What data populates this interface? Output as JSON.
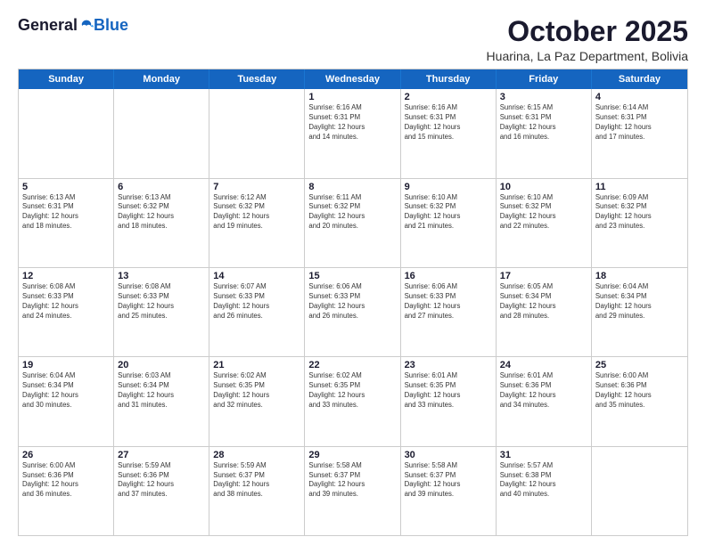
{
  "header": {
    "logo_general": "General",
    "logo_blue": "Blue",
    "month_title": "October 2025",
    "subtitle": "Huarina, La Paz Department, Bolivia"
  },
  "days_of_week": [
    "Sunday",
    "Monday",
    "Tuesday",
    "Wednesday",
    "Thursday",
    "Friday",
    "Saturday"
  ],
  "weeks": [
    [
      {
        "day": "",
        "info": ""
      },
      {
        "day": "",
        "info": ""
      },
      {
        "day": "",
        "info": ""
      },
      {
        "day": "1",
        "info": "Sunrise: 6:16 AM\nSunset: 6:31 PM\nDaylight: 12 hours\nand 14 minutes."
      },
      {
        "day": "2",
        "info": "Sunrise: 6:16 AM\nSunset: 6:31 PM\nDaylight: 12 hours\nand 15 minutes."
      },
      {
        "day": "3",
        "info": "Sunrise: 6:15 AM\nSunset: 6:31 PM\nDaylight: 12 hours\nand 16 minutes."
      },
      {
        "day": "4",
        "info": "Sunrise: 6:14 AM\nSunset: 6:31 PM\nDaylight: 12 hours\nand 17 minutes."
      }
    ],
    [
      {
        "day": "5",
        "info": "Sunrise: 6:13 AM\nSunset: 6:31 PM\nDaylight: 12 hours\nand 18 minutes."
      },
      {
        "day": "6",
        "info": "Sunrise: 6:13 AM\nSunset: 6:32 PM\nDaylight: 12 hours\nand 18 minutes."
      },
      {
        "day": "7",
        "info": "Sunrise: 6:12 AM\nSunset: 6:32 PM\nDaylight: 12 hours\nand 19 minutes."
      },
      {
        "day": "8",
        "info": "Sunrise: 6:11 AM\nSunset: 6:32 PM\nDaylight: 12 hours\nand 20 minutes."
      },
      {
        "day": "9",
        "info": "Sunrise: 6:10 AM\nSunset: 6:32 PM\nDaylight: 12 hours\nand 21 minutes."
      },
      {
        "day": "10",
        "info": "Sunrise: 6:10 AM\nSunset: 6:32 PM\nDaylight: 12 hours\nand 22 minutes."
      },
      {
        "day": "11",
        "info": "Sunrise: 6:09 AM\nSunset: 6:32 PM\nDaylight: 12 hours\nand 23 minutes."
      }
    ],
    [
      {
        "day": "12",
        "info": "Sunrise: 6:08 AM\nSunset: 6:33 PM\nDaylight: 12 hours\nand 24 minutes."
      },
      {
        "day": "13",
        "info": "Sunrise: 6:08 AM\nSunset: 6:33 PM\nDaylight: 12 hours\nand 25 minutes."
      },
      {
        "day": "14",
        "info": "Sunrise: 6:07 AM\nSunset: 6:33 PM\nDaylight: 12 hours\nand 26 minutes."
      },
      {
        "day": "15",
        "info": "Sunrise: 6:06 AM\nSunset: 6:33 PM\nDaylight: 12 hours\nand 26 minutes."
      },
      {
        "day": "16",
        "info": "Sunrise: 6:06 AM\nSunset: 6:33 PM\nDaylight: 12 hours\nand 27 minutes."
      },
      {
        "day": "17",
        "info": "Sunrise: 6:05 AM\nSunset: 6:34 PM\nDaylight: 12 hours\nand 28 minutes."
      },
      {
        "day": "18",
        "info": "Sunrise: 6:04 AM\nSunset: 6:34 PM\nDaylight: 12 hours\nand 29 minutes."
      }
    ],
    [
      {
        "day": "19",
        "info": "Sunrise: 6:04 AM\nSunset: 6:34 PM\nDaylight: 12 hours\nand 30 minutes."
      },
      {
        "day": "20",
        "info": "Sunrise: 6:03 AM\nSunset: 6:34 PM\nDaylight: 12 hours\nand 31 minutes."
      },
      {
        "day": "21",
        "info": "Sunrise: 6:02 AM\nSunset: 6:35 PM\nDaylight: 12 hours\nand 32 minutes."
      },
      {
        "day": "22",
        "info": "Sunrise: 6:02 AM\nSunset: 6:35 PM\nDaylight: 12 hours\nand 33 minutes."
      },
      {
        "day": "23",
        "info": "Sunrise: 6:01 AM\nSunset: 6:35 PM\nDaylight: 12 hours\nand 33 minutes."
      },
      {
        "day": "24",
        "info": "Sunrise: 6:01 AM\nSunset: 6:36 PM\nDaylight: 12 hours\nand 34 minutes."
      },
      {
        "day": "25",
        "info": "Sunrise: 6:00 AM\nSunset: 6:36 PM\nDaylight: 12 hours\nand 35 minutes."
      }
    ],
    [
      {
        "day": "26",
        "info": "Sunrise: 6:00 AM\nSunset: 6:36 PM\nDaylight: 12 hours\nand 36 minutes."
      },
      {
        "day": "27",
        "info": "Sunrise: 5:59 AM\nSunset: 6:36 PM\nDaylight: 12 hours\nand 37 minutes."
      },
      {
        "day": "28",
        "info": "Sunrise: 5:59 AM\nSunset: 6:37 PM\nDaylight: 12 hours\nand 38 minutes."
      },
      {
        "day": "29",
        "info": "Sunrise: 5:58 AM\nSunset: 6:37 PM\nDaylight: 12 hours\nand 39 minutes."
      },
      {
        "day": "30",
        "info": "Sunrise: 5:58 AM\nSunset: 6:37 PM\nDaylight: 12 hours\nand 39 minutes."
      },
      {
        "day": "31",
        "info": "Sunrise: 5:57 AM\nSunset: 6:38 PM\nDaylight: 12 hours\nand 40 minutes."
      },
      {
        "day": "",
        "info": ""
      }
    ]
  ]
}
